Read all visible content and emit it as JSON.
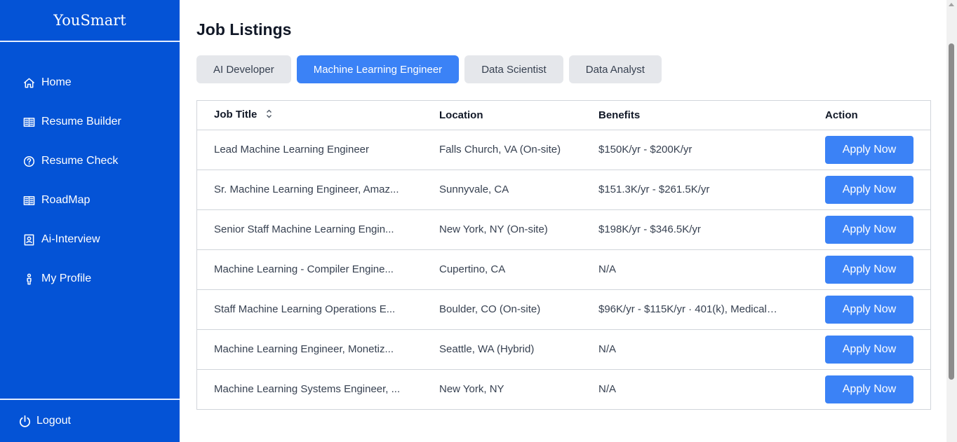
{
  "sidebar": {
    "brand": "YouSmart",
    "items": [
      {
        "label": "Home",
        "icon": "home-icon"
      },
      {
        "label": "Resume Builder",
        "icon": "book-icon"
      },
      {
        "label": "Resume Check",
        "icon": "help-circle-icon"
      },
      {
        "label": "RoadMap",
        "icon": "book-icon"
      },
      {
        "label": "Ai-Interview",
        "icon": "portrait-icon"
      },
      {
        "label": "My Profile",
        "icon": "person-icon"
      }
    ],
    "logout_label": "Logout"
  },
  "main": {
    "title": "Job Listings",
    "tabs": [
      {
        "label": "AI Developer",
        "active": false
      },
      {
        "label": "Machine Learning Engineer",
        "active": true
      },
      {
        "label": "Data Scientist",
        "active": false
      },
      {
        "label": "Data Analyst",
        "active": false
      }
    ],
    "table": {
      "headers": {
        "title": "Job Title",
        "location": "Location",
        "benefits": "Benefits",
        "action": "Action"
      },
      "rows": [
        {
          "title": "Lead Machine Learning Engineer",
          "location": "Falls Church, VA (On-site)",
          "benefits": "$150K/yr - $200K/yr",
          "action": "Apply Now"
        },
        {
          "title": "Sr. Machine Learning Engineer, Amaz...",
          "location": "Sunnyvale, CA",
          "benefits": "$151.3K/yr - $261.5K/yr",
          "action": "Apply Now"
        },
        {
          "title": "Senior Staff Machine Learning Engin...",
          "location": "New York, NY (On-site)",
          "benefits": "$198K/yr - $346.5K/yr",
          "action": "Apply Now"
        },
        {
          "title": "Machine Learning - Compiler Engine...",
          "location": "Cupertino, CA",
          "benefits": "N/A",
          "action": "Apply Now"
        },
        {
          "title": "Staff Machine Learning Operations E...",
          "location": "Boulder, CO (On-site)",
          "benefits": "$96K/yr - $115K/yr · 401(k), Medical, ...",
          "action": "Apply Now"
        },
        {
          "title": "Machine Learning Engineer, Monetiz...",
          "location": "Seattle, WA (Hybrid)",
          "benefits": "N/A",
          "action": "Apply Now"
        },
        {
          "title": "Machine Learning Systems Engineer, ...",
          "location": "New York, NY",
          "benefits": "N/A",
          "action": "Apply Now"
        }
      ]
    }
  },
  "colors": {
    "sidebar_bg": "#0453d6",
    "accent": "#3b82f6",
    "tab_inactive": "#e5e7eb"
  }
}
